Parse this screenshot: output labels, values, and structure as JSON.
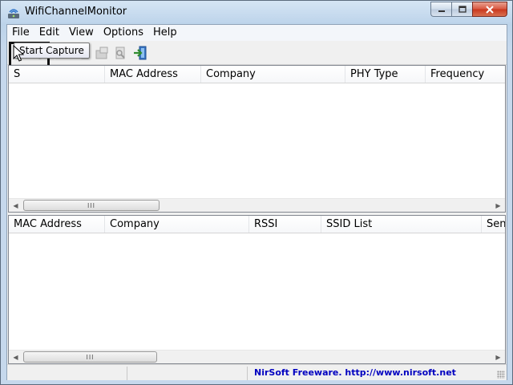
{
  "window": {
    "title": "WifiChannelMonitor"
  },
  "menu": {
    "items": [
      "File",
      "Edit",
      "View",
      "Options",
      "Help"
    ]
  },
  "toolbar": {
    "buttons": [
      {
        "icon": "play-icon",
        "enabled": true
      },
      {
        "icon": "stop-icon",
        "enabled": false
      },
      {
        "icon": "save-icon",
        "enabled": false
      },
      {
        "icon": "copy-icon",
        "enabled": false
      },
      {
        "icon": "properties-icon",
        "enabled": false
      },
      {
        "icon": "html-report-icon",
        "enabled": false
      },
      {
        "icon": "exit-icon",
        "enabled": true
      }
    ],
    "tooltip": "Start Capture"
  },
  "top_table": {
    "columns": [
      "S",
      "MAC Address",
      "Company",
      "PHY Type",
      "Frequency"
    ],
    "rows": []
  },
  "bottom_table": {
    "columns": [
      "MAC Address",
      "Company",
      "RSSI",
      "SSID List",
      "Sent"
    ],
    "rows": []
  },
  "scrollbar_grip": "III",
  "status": {
    "link_text": "NirSoft Freeware.  http://www.nirsoft.net"
  },
  "colors": {
    "accent": "#0000c0",
    "play_green": "#2aa52a"
  }
}
